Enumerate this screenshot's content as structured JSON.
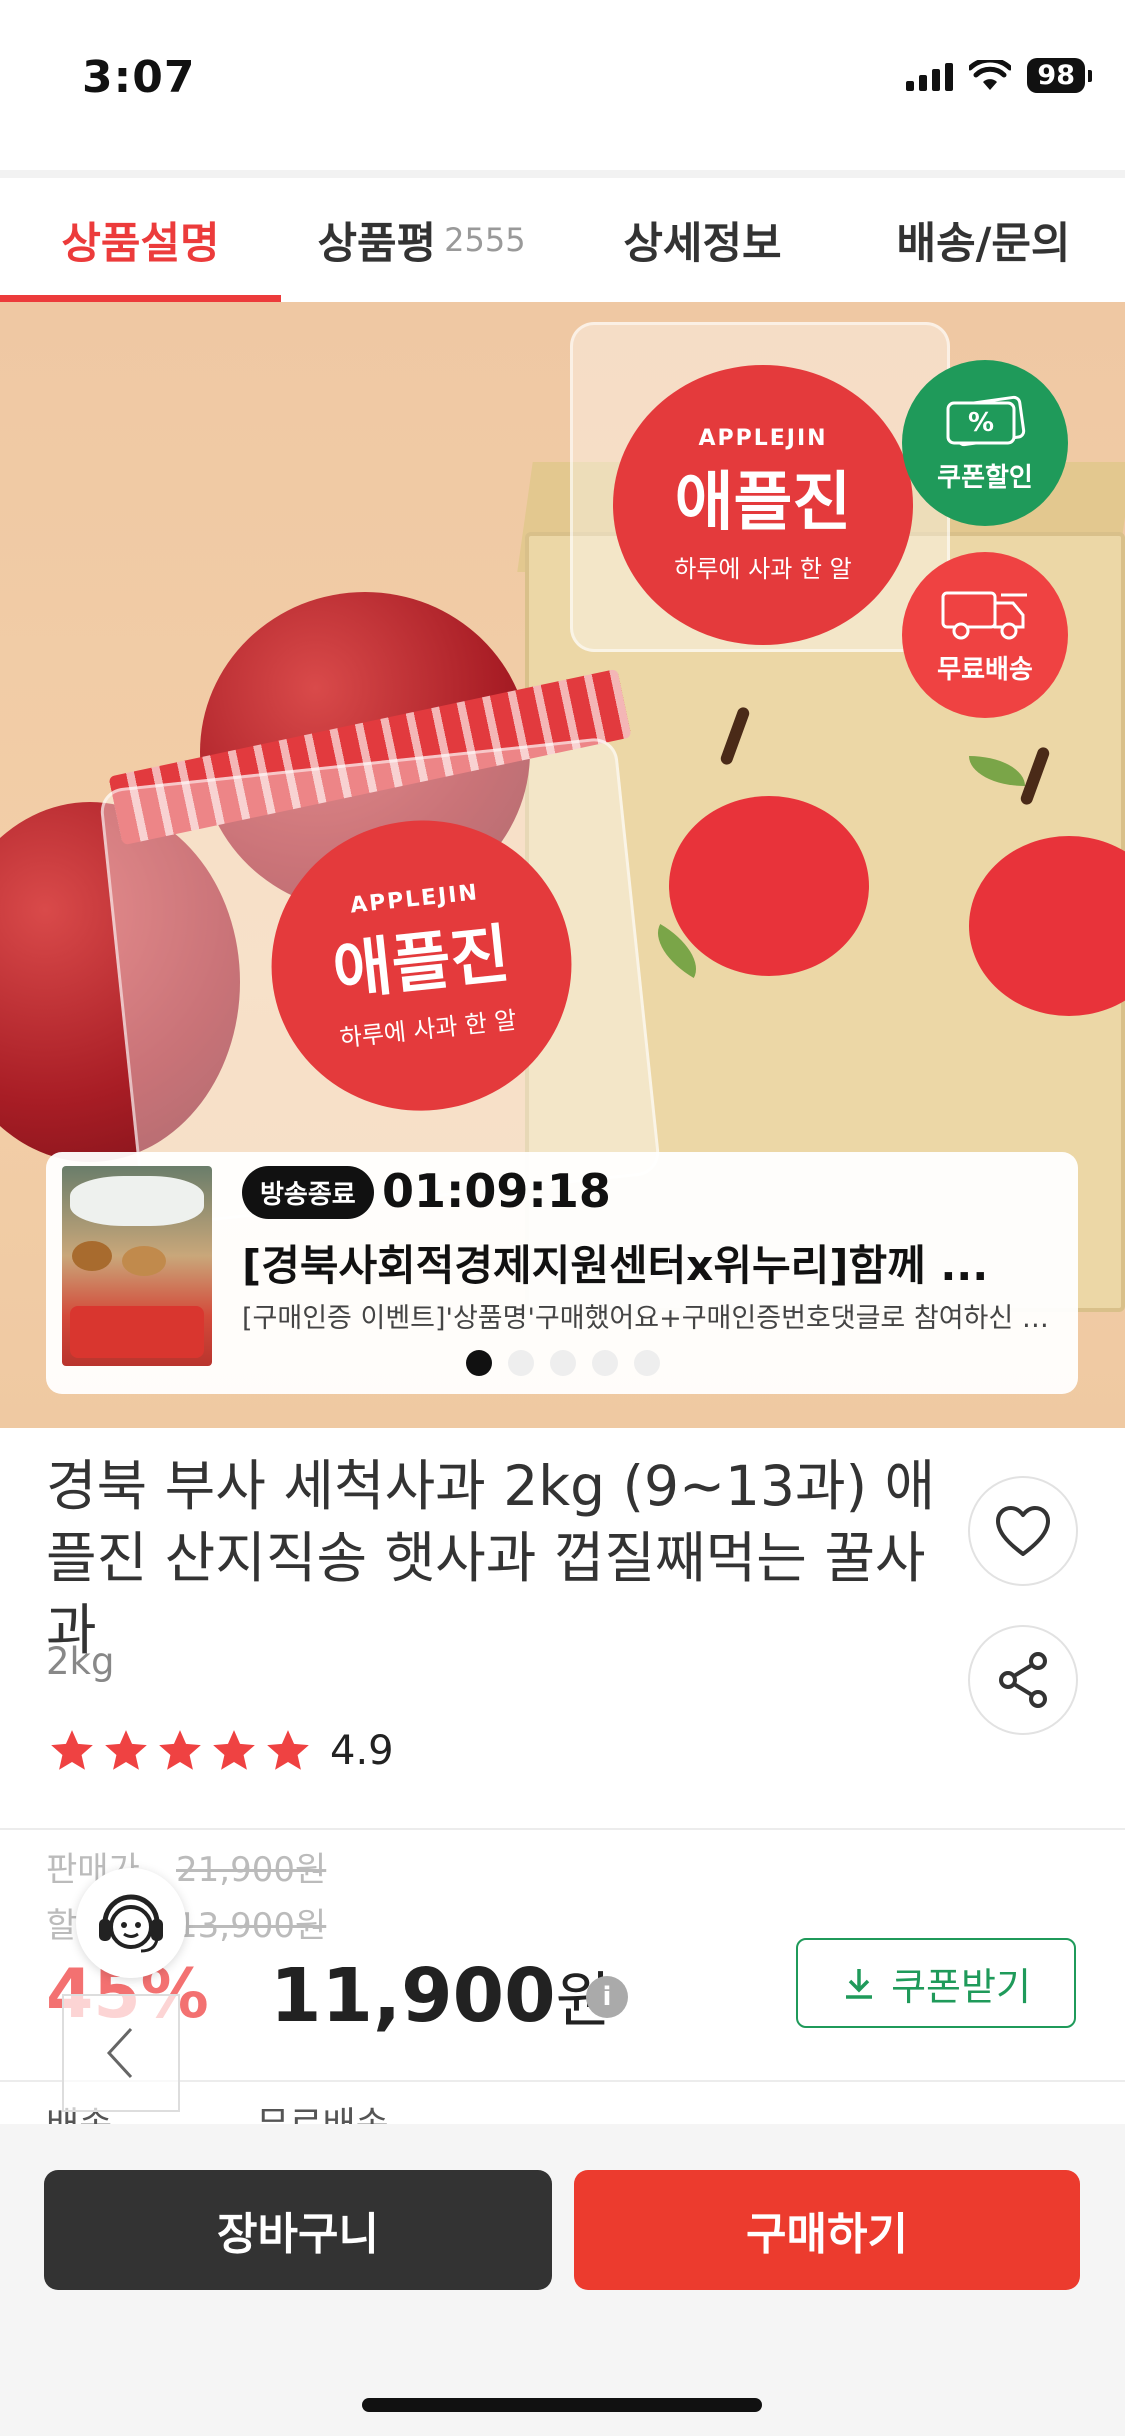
{
  "status_bar": {
    "time": "3:07",
    "battery": "98"
  },
  "tabs": [
    {
      "label": "상품설명",
      "count": ""
    },
    {
      "label": "상품평",
      "count": "2555"
    },
    {
      "label": "상세정보",
      "count": ""
    },
    {
      "label": "배송/문의",
      "count": ""
    }
  ],
  "hero": {
    "brand_en": "APPLEJIN",
    "brand_kr": "애플진",
    "slogan": "하루에 사과 한 알",
    "badges": {
      "coupon": "쿠폰할인",
      "coupon_symbol": "%",
      "shipping": "무료배송"
    }
  },
  "live": {
    "status": "방송종료",
    "timer": "01:09:18",
    "title": "[경북사회적경제지원센터x위누리]함께 ...",
    "description": "[구매인증 이벤트]'상품명'구매했어요+구매인증번호댓글로 참여하신 분들...",
    "slide_count": 5,
    "active_slide": 0
  },
  "product": {
    "title": "경북 부사 세척사과 2kg (9~13과) 애플진 산지직송 햇사과 껍질째먹는 꿀사과",
    "option": "2kg",
    "rating": "4.9",
    "rating_stars": 5
  },
  "price": {
    "sale_label": "판매가",
    "sale_price": "21,900원",
    "discount_label": "할인가",
    "discount_price": "13,900원",
    "discount_rate": "45%",
    "final_price": "11,900",
    "currency": "원",
    "info_symbol": "i",
    "coupon_button": "쿠폰받기"
  },
  "shipping": {
    "label": "배송",
    "value": "무료배송"
  },
  "bottom": {
    "cart": "장바구니",
    "buy": "구매하기"
  },
  "colors": {
    "accent": "#ec3b3b",
    "green": "#1f9a5a",
    "buy": "#ec3b2e"
  }
}
